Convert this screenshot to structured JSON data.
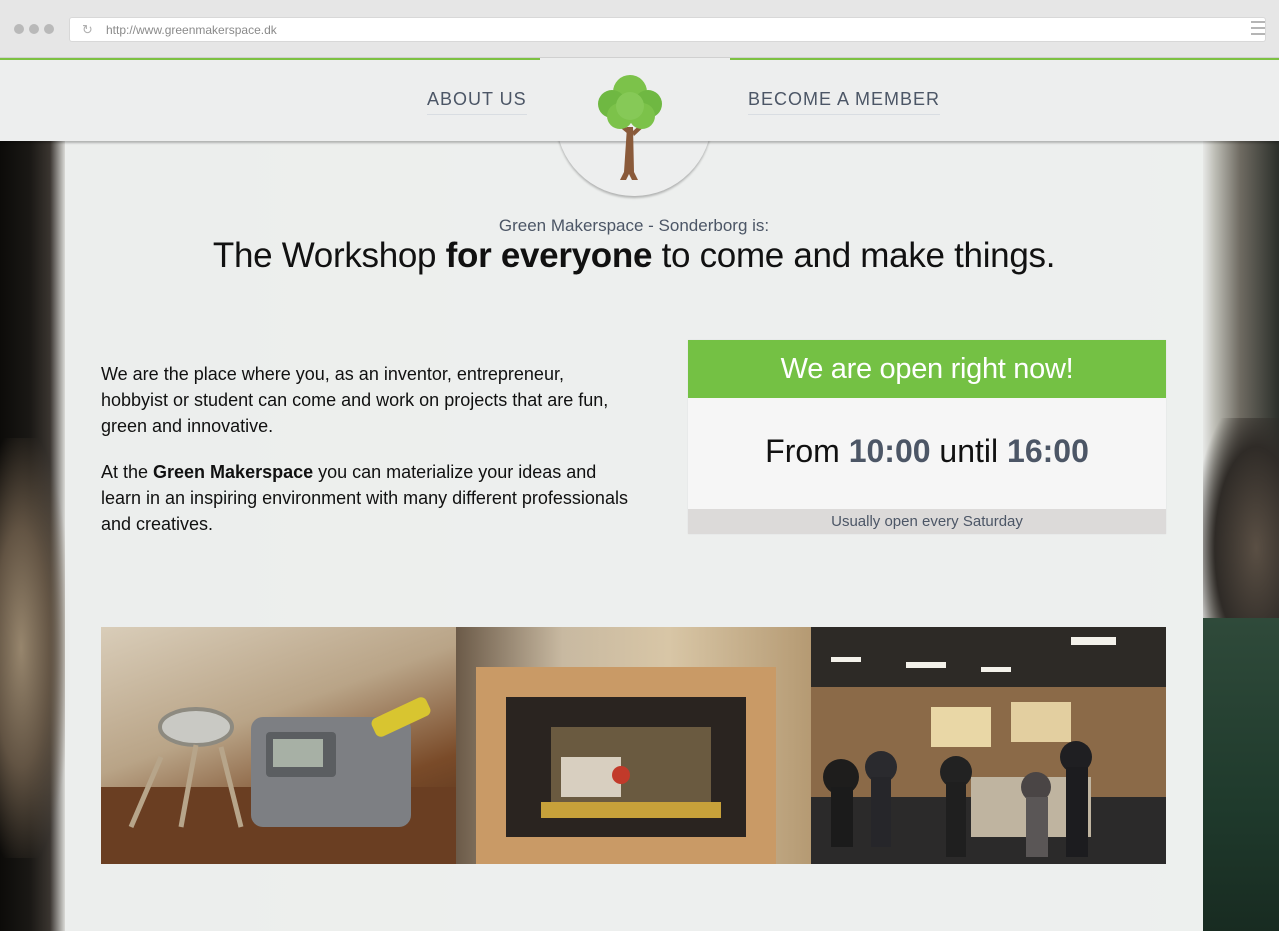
{
  "browser": {
    "url": "http://www.greenmakerspace.dk"
  },
  "nav": {
    "about": "ABOUT US",
    "member": "BECOME A MEMBER"
  },
  "hero": {
    "tagline": "Green Makerspace - Sonderborg is:",
    "headline_pre": "The Workshop ",
    "headline_bold": "for everyone",
    "headline_post": " to come and make things."
  },
  "intro": {
    "p1": "We are the place where you, as an inventor, entrepreneur, hobbyist or student can come and work on projects that are fun, green and innovative.",
    "p2_pre": "At the ",
    "p2_bold": "Green Makerspace",
    "p2_post": " you can materialize your ideas and learn in an inspiring environment with many different professionals and creatives."
  },
  "open": {
    "status": "We are open right now!",
    "from_label": "From ",
    "from_time": "10:00",
    "until_label": " until ",
    "until_time": "16:00",
    "note": "Usually open every Saturday"
  },
  "colors": {
    "accent_green": "#74c144",
    "text_slate": "#4c5666"
  },
  "icons": {
    "logo": "tree-wrench-icon",
    "reload": "reload-icon",
    "menu": "hamburger-menu-icon"
  }
}
